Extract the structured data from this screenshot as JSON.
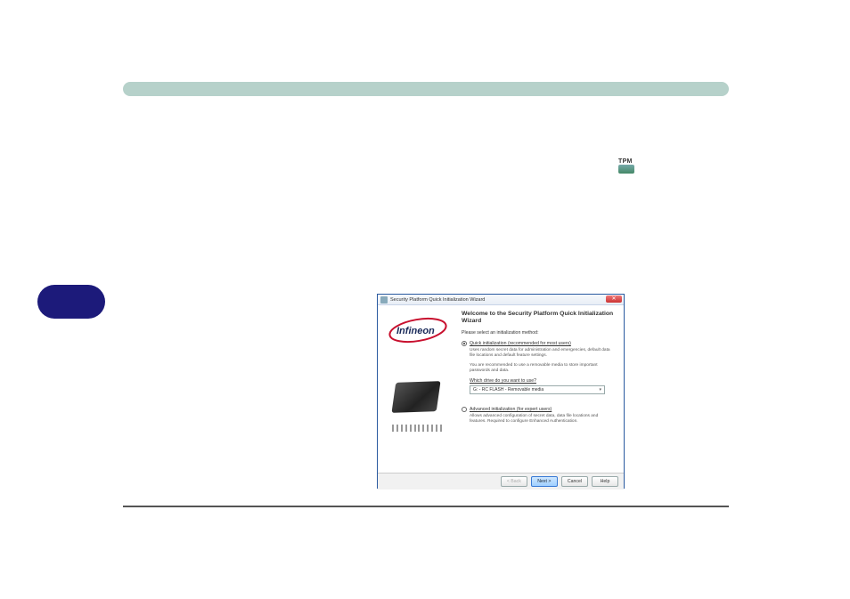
{
  "header_section_title": "",
  "wizard": {
    "titlebar": "Security Platform Quick Initialization Wizard",
    "close_glyph": "✕",
    "heading": "Welcome to the Security Platform Quick Initialization Wizard",
    "please_select": "Please select an initialization method:",
    "quick": {
      "label": "Quick initialization (recommended for most users)",
      "desc_line1": "Uses random secret data for administration and emergencies, default data file locations and default feature settings.",
      "desc_line2": "You are recommended to use a removable media to store important passwords and data."
    },
    "drive_question": "Which drive do you want to use?",
    "drive_value": "G: - RC FLASH - Removable media",
    "advanced": {
      "label": "Advanced initialization (for expert users)",
      "desc": "Allows advanced configuration of secret data, data file locations and features. Required to configure Enhanced Authentication."
    },
    "buttons": {
      "back": "< Back",
      "next": "Next >",
      "cancel": "Cancel",
      "help": "Help"
    }
  },
  "logo_text": "Infineon",
  "tpm_label": "TPM"
}
